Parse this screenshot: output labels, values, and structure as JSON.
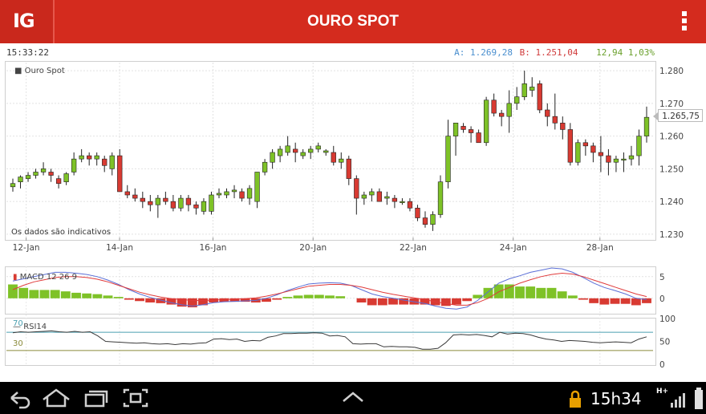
{
  "app": {
    "logo": "IG",
    "title": "OURO SPOT"
  },
  "info": {
    "time": "15:33:22",
    "ask": "A: 1.269,28",
    "bid": "B: 1.251,04",
    "change": "12,94 1,03%"
  },
  "colors": {
    "brand": "#d42b1e",
    "up": "#7ec227",
    "down": "#d83a32",
    "macd_line": "#5b6fd6",
    "signal_line": "#e03b3b",
    "rsi_line": "#3a3a3a",
    "rsi70": "#4b9fb0",
    "rsi30": "#8a8a3a"
  },
  "main_chart": {
    "legend": "Ouro Spot",
    "note": "Os dados são indicativos",
    "last_price": "1.265,75"
  },
  "macd_chart": {
    "legend": "MACD 12 26 9"
  },
  "rsi_chart": {
    "legend": "RSI14",
    "level_high": "70",
    "level_low": "30"
  },
  "status_bar": {
    "clock": "15h34",
    "network": "H+"
  },
  "chart_data": [
    {
      "type": "candlestick",
      "title": "Ouro Spot",
      "x_tick_labels": [
        "12-Jan",
        "14-Jan",
        "16-Jan",
        "20-Jan",
        "22-Jan",
        "24-Jan",
        "28-Jan"
      ],
      "y_tick_labels": [
        "1.280",
        "1.270",
        "1.260",
        "1.250",
        "1.240",
        "1.230"
      ],
      "ylim": [
        1229,
        1281
      ],
      "ohlc": [
        [
          1244.5,
          1247,
          1243,
          1245.5
        ],
        [
          1246,
          1248,
          1244,
          1247.5
        ],
        [
          1247,
          1249,
          1246,
          1248
        ],
        [
          1248,
          1250,
          1247,
          1249
        ],
        [
          1249,
          1252,
          1248,
          1250
        ],
        [
          1249,
          1250,
          1246,
          1248
        ],
        [
          1247,
          1248,
          1244,
          1245.5
        ],
        [
          1246,
          1249,
          1245,
          1248.5
        ],
        [
          1249,
          1255,
          1248,
          1253
        ],
        [
          1253,
          1256,
          1252,
          1254
        ],
        [
          1254,
          1255,
          1251,
          1253
        ],
        [
          1253,
          1255,
          1251,
          1254
        ],
        [
          1253,
          1254,
          1249,
          1251
        ],
        [
          1250,
          1255,
          1248,
          1254
        ],
        [
          1254,
          1256,
          1246,
          1243
        ],
        [
          1243,
          1245,
          1241,
          1242
        ],
        [
          1242,
          1244,
          1240,
          1241
        ],
        [
          1241,
          1243,
          1238,
          1240
        ],
        [
          1240,
          1242,
          1237,
          1239
        ],
        [
          1239,
          1242,
          1235,
          1241
        ],
        [
          1241,
          1243,
          1239,
          1240
        ],
        [
          1240,
          1242,
          1237,
          1238
        ],
        [
          1238,
          1242,
          1237,
          1241
        ],
        [
          1241,
          1242,
          1237,
          1239
        ],
        [
          1239,
          1240,
          1236,
          1238
        ],
        [
          1237,
          1241,
          1236,
          1240
        ],
        [
          1237,
          1243,
          1236,
          1242
        ],
        [
          1242,
          1244,
          1241,
          1242.5
        ],
        [
          1242,
          1244,
          1241,
          1243
        ],
        [
          1243,
          1245,
          1241,
          1243.5
        ],
        [
          1243,
          1244,
          1240,
          1241
        ],
        [
          1241,
          1245,
          1239,
          1244
        ],
        [
          1240,
          1249,
          1238,
          1249
        ],
        [
          1249,
          1253,
          1248,
          1252
        ],
        [
          1252,
          1256,
          1250,
          1255
        ],
        [
          1254,
          1257,
          1252,
          1256
        ],
        [
          1255,
          1260,
          1254,
          1257
        ],
        [
          1256,
          1258,
          1252,
          1255
        ],
        [
          1254,
          1256,
          1253,
          1255
        ],
        [
          1255,
          1257,
          1253,
          1256
        ],
        [
          1256,
          1258,
          1255,
          1257
        ],
        [
          1255,
          1256,
          1254,
          1255.5
        ],
        [
          1255,
          1257,
          1251,
          1252
        ],
        [
          1252,
          1255,
          1250,
          1253
        ],
        [
          1253,
          1254,
          1245,
          1247
        ],
        [
          1247,
          1248,
          1236,
          1241
        ],
        [
          1241,
          1243,
          1239,
          1242
        ],
        [
          1242,
          1244,
          1240,
          1243
        ],
        [
          1243,
          1244,
          1240,
          1240
        ],
        [
          1241,
          1243,
          1239,
          1241.5
        ],
        [
          1241,
          1242,
          1238,
          1240
        ],
        [
          1240,
          1241,
          1239,
          1240
        ],
        [
          1240,
          1241,
          1237,
          1238
        ],
        [
          1238,
          1239,
          1234,
          1235
        ],
        [
          1235,
          1237,
          1232,
          1233
        ],
        [
          1233,
          1237,
          1231,
          1236
        ],
        [
          1236,
          1248,
          1235,
          1246
        ],
        [
          1246,
          1265,
          1244,
          1260
        ],
        [
          1260,
          1263,
          1254,
          1264
        ],
        [
          1263,
          1264,
          1261,
          1262
        ],
        [
          1262,
          1263,
          1258,
          1261
        ],
        [
          1261,
          1262,
          1258,
          1258
        ],
        [
          1258,
          1272,
          1257,
          1271
        ],
        [
          1271,
          1273,
          1266,
          1267
        ],
        [
          1267,
          1268,
          1263,
          1266
        ],
        [
          1266,
          1274,
          1261,
          1270
        ],
        [
          1270,
          1275,
          1268,
          1272
        ],
        [
          1272,
          1280,
          1271,
          1276
        ],
        [
          1274,
          1278,
          1272,
          1275
        ],
        [
          1276,
          1277,
          1267,
          1268
        ],
        [
          1268,
          1270,
          1263,
          1266
        ],
        [
          1266,
          1273,
          1262,
          1264
        ],
        [
          1264,
          1266,
          1259,
          1262
        ],
        [
          1262,
          1264,
          1251,
          1252
        ],
        [
          1252,
          1259,
          1251,
          1258
        ],
        [
          1258,
          1259,
          1254,
          1257
        ],
        [
          1257,
          1258,
          1252,
          1255
        ],
        [
          1255,
          1260,
          1249,
          1254
        ],
        [
          1254,
          1256,
          1248,
          1252
        ],
        [
          1252,
          1254,
          1249,
          1253
        ],
        [
          1253,
          1255,
          1249,
          1253
        ],
        [
          1253,
          1257,
          1251,
          1254
        ],
        [
          1254,
          1262,
          1251,
          1260
        ],
        [
          1260,
          1269,
          1258,
          1265.75
        ]
      ]
    },
    {
      "type": "line",
      "title": "MACD 12 26 9",
      "y_tick_labels": [
        "5",
        "0"
      ],
      "ylim": [
        -3,
        7
      ],
      "series": [
        {
          "name": "MACD",
          "values": [
            4,
            4.5,
            5,
            5.5,
            6,
            6,
            5.8,
            5.5,
            5,
            4.2,
            3.2,
            2,
            1,
            0.2,
            -0.4,
            -1,
            -1.5,
            -1.8,
            -1.5,
            -1,
            -0.8,
            -0.7,
            -0.6,
            -0.5,
            0,
            0.8,
            1.8,
            2.6,
            3.3,
            3.5,
            3.6,
            3.5,
            3,
            2,
            1,
            0.4,
            0,
            -0.4,
            -0.8,
            -1.2,
            -1.8,
            -2.3,
            -2.5,
            -2,
            -0.5,
            1.5,
            3.5,
            4.5,
            5.2,
            6,
            6.5,
            7,
            6.8,
            6,
            4.8,
            3.5,
            2.5,
            1.8,
            1,
            0,
            -0.3
          ]
        },
        {
          "name": "Signal",
          "values": [
            2,
            3,
            3.8,
            4.3,
            4.8,
            5,
            5,
            4.8,
            4.4,
            3.8,
            3,
            2.2,
            1.4,
            0.8,
            0.3,
            -0.1,
            -0.3,
            -0.5,
            -0.5,
            -0.4,
            -0.3,
            -0.2,
            -0.1,
            0.1,
            0.5,
            1,
            1.6,
            2.2,
            2.8,
            3,
            3.2,
            3.2,
            3,
            2.6,
            2,
            1.4,
            0.9,
            0.5,
            0.1,
            -0.3,
            -0.8,
            -1.2,
            -1.6,
            -1.6,
            -1,
            0,
            1.5,
            2.5,
            3.5,
            4.3,
            5,
            5.5,
            5.8,
            5.6,
            5,
            4.2,
            3.4,
            2.6,
            1.8,
            1,
            0.4
          ]
        }
      ]
    },
    {
      "type": "line",
      "title": "RSI14",
      "y_tick_labels": [
        "100",
        "50",
        "0"
      ],
      "ylim": [
        0,
        100
      ],
      "series": [
        {
          "name": "RSI14",
          "values": [
            69,
            71,
            70,
            71,
            72,
            73,
            71,
            70,
            72,
            70,
            71,
            62,
            50,
            49,
            48,
            47,
            46,
            47,
            45,
            44,
            45,
            43,
            45,
            44,
            46,
            47,
            55,
            56,
            54,
            55,
            50,
            52,
            51,
            59,
            62,
            67,
            67,
            68,
            68,
            69,
            68,
            62,
            63,
            60,
            45,
            44,
            45,
            45,
            38,
            39,
            38,
            38,
            37,
            33,
            33,
            35,
            47,
            64,
            65,
            64,
            65,
            63,
            60,
            70,
            66,
            68,
            67,
            64,
            59,
            55,
            53,
            50,
            52,
            51,
            50,
            48,
            47,
            48,
            49,
            48,
            47,
            55,
            60
          ]
        }
      ]
    }
  ]
}
